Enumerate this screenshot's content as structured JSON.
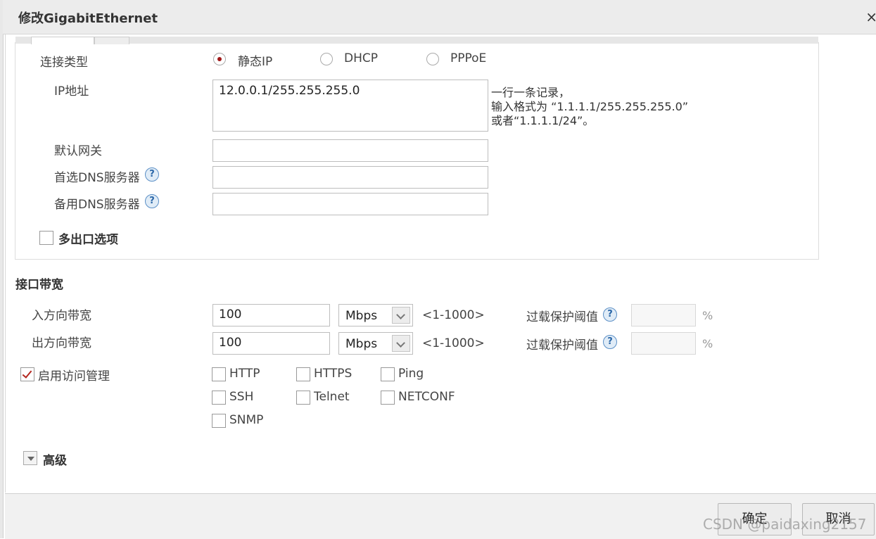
{
  "dialog": {
    "title": "修改GigabitEthernet",
    "close": "×"
  },
  "connection": {
    "type_label": "连接类型",
    "options": [
      {
        "label": "静态IP",
        "selected": true
      },
      {
        "label": "DHCP",
        "selected": false
      },
      {
        "label": "PPPoE",
        "selected": false
      }
    ],
    "ip_label": "IP地址",
    "ip_value": "12.0.0.1/255.255.255.0",
    "ip_hint": [
      "一行一条记录，",
      "输入格式为 “1.1.1.1/255.255.255.0”",
      "或者“1.1.1.1/24”。"
    ],
    "gateway_label": "默认网关",
    "gateway_value": "",
    "dns1_label": "首选DNS服务器",
    "dns1_value": "",
    "dns2_label": "备用DNS服务器",
    "dns2_value": "",
    "help_glyph": "?",
    "multi_exit_label": "多出口选项",
    "multi_exit_checked": false
  },
  "bandwidth": {
    "section_title": "接口带宽",
    "inbound_label": "入方向带宽",
    "inbound_value": "100",
    "inbound_unit": "Mbps",
    "outbound_label": "出方向带宽",
    "outbound_value": "100",
    "outbound_unit": "Mbps",
    "range_text": "<1-1000>",
    "overload_label": "过载保护阈值",
    "overload_in_value": "",
    "overload_out_value": "",
    "percent": "%"
  },
  "access": {
    "enable_label": "启用访问管理",
    "enabled": true,
    "services": [
      {
        "label": "HTTP",
        "checked": false
      },
      {
        "label": "HTTPS",
        "checked": false
      },
      {
        "label": "Ping",
        "checked": false
      },
      {
        "label": "SSH",
        "checked": false
      },
      {
        "label": "Telnet",
        "checked": false
      },
      {
        "label": "NETCONF",
        "checked": false
      },
      {
        "label": "SNMP",
        "checked": false
      }
    ]
  },
  "advanced": {
    "label": "高级"
  },
  "footer": {
    "ok_label": "确定",
    "cancel_label": "取消"
  },
  "watermark": "CSDN @paidaxing2157",
  "colors": {
    "accent_red": "#a01818",
    "help_blue": "#2b67a8",
    "titlebar": "#ececec"
  }
}
